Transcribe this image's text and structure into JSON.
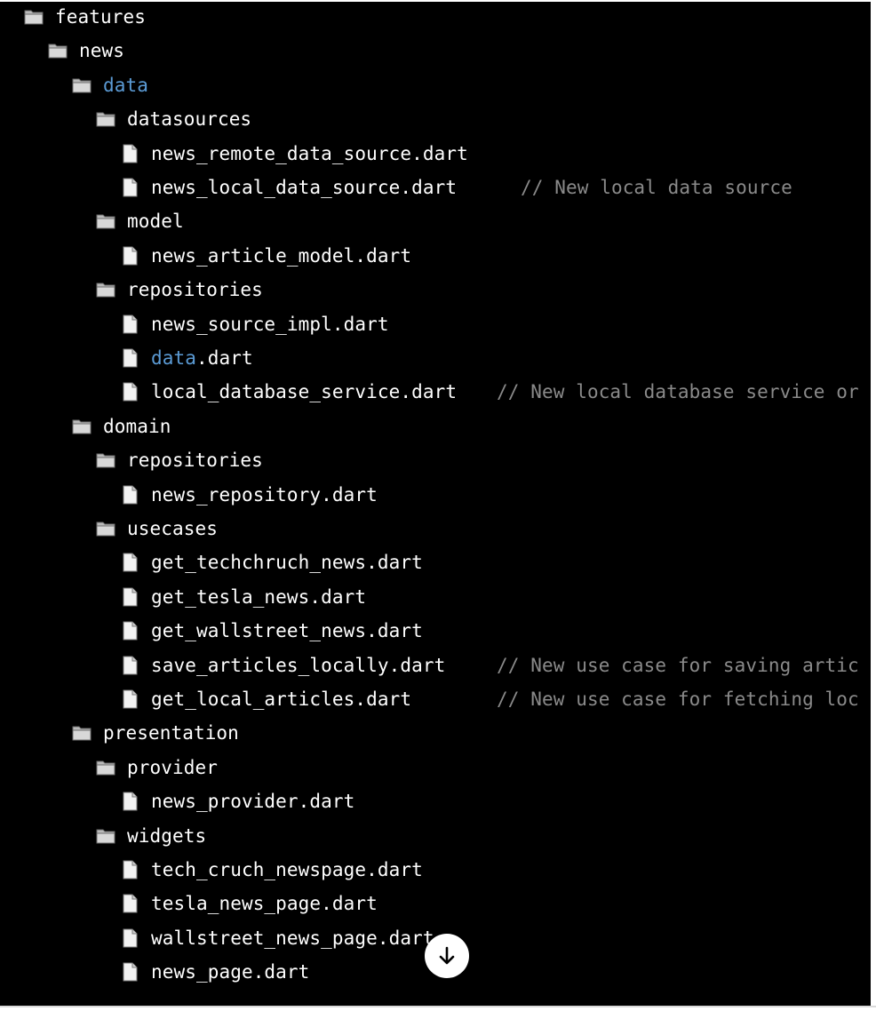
{
  "tree": [
    {
      "type": "folder",
      "depth": 0,
      "name": "features"
    },
    {
      "type": "folder",
      "depth": 1,
      "name": "news"
    },
    {
      "type": "folder",
      "depth": 2,
      "name": "data",
      "highlight": true
    },
    {
      "type": "folder",
      "depth": 3,
      "name": "datasources"
    },
    {
      "type": "file",
      "depth": 4,
      "name": "news_remote_data_source.dart"
    },
    {
      "type": "file",
      "depth": 4,
      "name": "news_local_data_source.dart",
      "comment": "// New local data source"
    },
    {
      "type": "folder",
      "depth": 3,
      "name": "model"
    },
    {
      "type": "file",
      "depth": 4,
      "name": "news_article_model.dart"
    },
    {
      "type": "folder",
      "depth": 3,
      "name": "repositories"
    },
    {
      "type": "file",
      "depth": 4,
      "name": "news_source_impl.dart"
    },
    {
      "type": "file",
      "depth": 4,
      "name_highlight": "data",
      "name": ".dart"
    },
    {
      "type": "file",
      "depth": 4,
      "name": "local_database_service.dart",
      "comment": "// New local database service or"
    },
    {
      "type": "folder",
      "depth": 2,
      "name": "domain"
    },
    {
      "type": "folder",
      "depth": 3,
      "name": "repositories"
    },
    {
      "type": "file",
      "depth": 4,
      "name": "news_repository.dart"
    },
    {
      "type": "folder",
      "depth": 3,
      "name": "usecases"
    },
    {
      "type": "file",
      "depth": 4,
      "name": "get_techchruch_news.dart"
    },
    {
      "type": "file",
      "depth": 4,
      "name": "get_tesla_news.dart"
    },
    {
      "type": "file",
      "depth": 4,
      "name": "get_wallstreet_news.dart"
    },
    {
      "type": "file",
      "depth": 4,
      "name": "save_articles_locally.dart",
      "comment": "// New use case for saving artic"
    },
    {
      "type": "file",
      "depth": 4,
      "name": "get_local_articles.dart",
      "comment": "// New use case for fetching loc"
    },
    {
      "type": "folder",
      "depth": 2,
      "name": "presentation"
    },
    {
      "type": "folder",
      "depth": 3,
      "name": "provider"
    },
    {
      "type": "file",
      "depth": 4,
      "name": "news_provider.dart"
    },
    {
      "type": "folder",
      "depth": 3,
      "name": "widgets"
    },
    {
      "type": "file",
      "depth": 4,
      "name": "tech_cruch_newspage.dart"
    },
    {
      "type": "file",
      "depth": 4,
      "name": "tesla_news_page.dart"
    },
    {
      "type": "file",
      "depth": 4,
      "name": "wallstreet_news_page.dart"
    },
    {
      "type": "file",
      "depth": 4,
      "name": "news_page.dart"
    }
  ],
  "icons": {
    "folder": "folder-icon",
    "file": "file-icon",
    "scroll": "arrow-down-icon"
  },
  "colors": {
    "background": "#000000",
    "text": "#ffffff",
    "comment": "#8a8a8a",
    "highlight": "#5b9bd5"
  }
}
